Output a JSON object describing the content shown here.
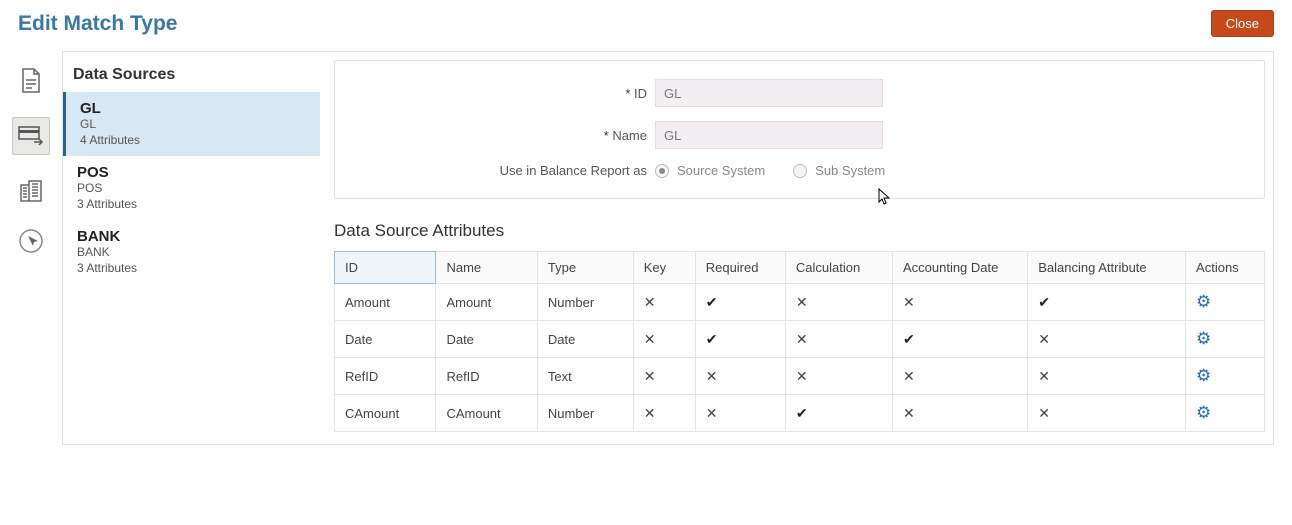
{
  "header": {
    "title": "Edit Match Type",
    "close_label": "Close"
  },
  "sidebar": {
    "header": "Data Sources",
    "items": [
      {
        "title": "GL",
        "sub1": "GL",
        "sub2": "4 Attributes",
        "selected": true
      },
      {
        "title": "POS",
        "sub1": "POS",
        "sub2": "3 Attributes",
        "selected": false
      },
      {
        "title": "BANK",
        "sub1": "BANK",
        "sub2": "3 Attributes",
        "selected": false
      }
    ]
  },
  "form": {
    "id_label": "ID",
    "id_value": "GL",
    "name_label": "Name",
    "name_value": "GL",
    "balance_label": "Use in Balance Report as",
    "opt_source": "Source System",
    "opt_sub": "Sub System"
  },
  "attributes": {
    "title": "Data Source Attributes",
    "columns": {
      "id": "ID",
      "name": "Name",
      "type": "Type",
      "key": "Key",
      "required": "Required",
      "calculation": "Calculation",
      "accounting_date": "Accounting Date",
      "balancing": "Balancing Attribute",
      "actions": "Actions"
    },
    "rows": [
      {
        "id": "Amount",
        "name": "Amount",
        "type": "Number",
        "key": false,
        "required": true,
        "calculation": false,
        "accounting_date": false,
        "balancing": true
      },
      {
        "id": "Date",
        "name": "Date",
        "type": "Date",
        "key": false,
        "required": true,
        "calculation": false,
        "accounting_date": true,
        "balancing": false
      },
      {
        "id": "RefID",
        "name": "RefID",
        "type": "Text",
        "key": false,
        "required": false,
        "calculation": false,
        "accounting_date": false,
        "balancing": false
      },
      {
        "id": "CAmount",
        "name": "CAmount",
        "type": "Number",
        "key": false,
        "required": false,
        "calculation": true,
        "accounting_date": false,
        "balancing": false
      }
    ]
  }
}
